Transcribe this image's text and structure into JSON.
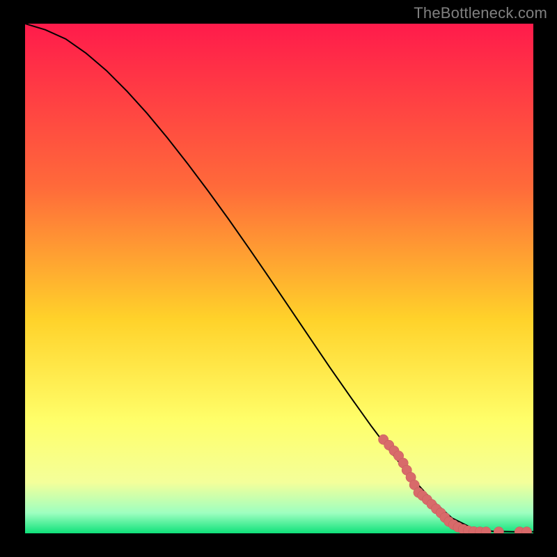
{
  "attribution": "TheBottleneck.com",
  "colors": {
    "black": "#000000",
    "curve": "#000000",
    "dots": "#d86a6a",
    "dots_stroke": "#c45a5a",
    "gradient_top": "#ff1b4b",
    "gradient_mid_upper": "#ff6a3a",
    "gradient_mid": "#ffd22a",
    "gradient_mid_lower": "#ffff6a",
    "gradient_lower": "#f4ff9a",
    "gradient_green_light": "#9effc0",
    "gradient_green": "#0fe27a"
  },
  "chart_data": {
    "type": "line",
    "title": "",
    "xlabel": "",
    "ylabel": "",
    "xlim": [
      0,
      100
    ],
    "ylim": [
      0,
      100
    ],
    "curve": {
      "x": [
        0,
        4,
        8,
        12,
        16,
        20,
        24,
        28,
        32,
        36,
        40,
        44,
        48,
        52,
        56,
        60,
        64,
        68,
        72,
        76,
        80,
        84,
        88,
        92,
        96,
        100
      ],
      "y": [
        100,
        98.8,
        97.0,
        94.2,
        90.8,
        86.8,
        82.4,
        77.6,
        72.5,
        67.2,
        61.7,
        56.0,
        50.2,
        44.3,
        38.4,
        32.5,
        26.8,
        21.2,
        15.9,
        11.0,
        6.6,
        3.0,
        1.0,
        0.4,
        0.3,
        0.3
      ]
    },
    "dot_cluster": {
      "name": "highlighted data points",
      "points": [
        {
          "x": 70.5,
          "y": 18.4
        },
        {
          "x": 71.6,
          "y": 17.3
        },
        {
          "x": 72.6,
          "y": 16.2
        },
        {
          "x": 73.5,
          "y": 15.2
        },
        {
          "x": 74.4,
          "y": 13.8
        },
        {
          "x": 75.1,
          "y": 12.4
        },
        {
          "x": 75.9,
          "y": 11.0
        },
        {
          "x": 76.6,
          "y": 9.5
        },
        {
          "x": 77.4,
          "y": 8.0
        },
        {
          "x": 78.2,
          "y": 7.4
        },
        {
          "x": 79.1,
          "y": 6.6
        },
        {
          "x": 80.0,
          "y": 5.7
        },
        {
          "x": 80.9,
          "y": 4.8
        },
        {
          "x": 81.8,
          "y": 4.0
        },
        {
          "x": 82.6,
          "y": 3.1
        },
        {
          "x": 83.4,
          "y": 2.3
        },
        {
          "x": 84.3,
          "y": 1.7
        },
        {
          "x": 85.2,
          "y": 1.2
        },
        {
          "x": 86.2,
          "y": 0.8
        },
        {
          "x": 87.2,
          "y": 0.5
        },
        {
          "x": 88.3,
          "y": 0.35
        },
        {
          "x": 89.5,
          "y": 0.3
        },
        {
          "x": 90.7,
          "y": 0.3
        },
        {
          "x": 93.2,
          "y": 0.3
        },
        {
          "x": 97.3,
          "y": 0.3
        },
        {
          "x": 98.7,
          "y": 0.3
        }
      ]
    }
  }
}
